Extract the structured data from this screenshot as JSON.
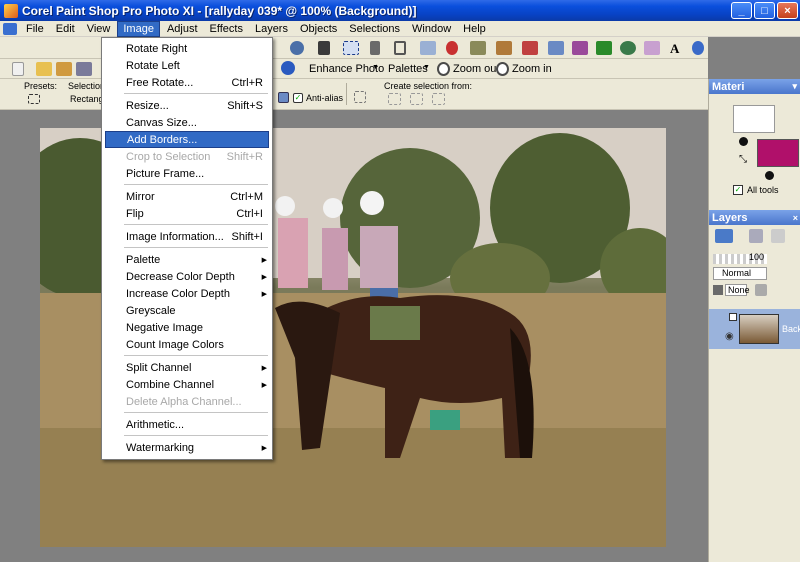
{
  "window": {
    "title": "Corel Paint Shop Pro Photo XI - [rallyday 039* @ 100% (Background)]",
    "controls": {
      "minimize": "_",
      "maximize": "□",
      "close": "×"
    }
  },
  "menubar": {
    "items": [
      {
        "label": "File"
      },
      {
        "label": "Edit"
      },
      {
        "label": "View"
      },
      {
        "label": "Image",
        "active": true
      },
      {
        "label": "Adjust"
      },
      {
        "label": "Effects"
      },
      {
        "label": "Layers"
      },
      {
        "label": "Objects"
      },
      {
        "label": "Selections"
      },
      {
        "label": "Window"
      },
      {
        "label": "Help"
      }
    ]
  },
  "toolbar2": {
    "enhance_photo": "Enhance Photo",
    "palettes": "Palettes",
    "zoom_out": "Zoom out",
    "zoom_in": "Zoom in"
  },
  "tool_options": {
    "presets_label": "Presets:",
    "selection_label": "Selection",
    "selection_value": "Rectangle",
    "anti_alias_label": "Anti-alias",
    "anti_alias_checked": true,
    "create_selection_label": "Create selection from:"
  },
  "image_menu": {
    "groups": [
      [
        {
          "label": "Rotate Right",
          "shortcut": ""
        },
        {
          "label": "Rotate Left",
          "shortcut": ""
        },
        {
          "label": "Free Rotate...",
          "shortcut": "Ctrl+R"
        }
      ],
      [
        {
          "label": "Resize...",
          "shortcut": "Shift+S"
        },
        {
          "label": "Canvas Size...",
          "shortcut": ""
        },
        {
          "label": "Add Borders...",
          "shortcut": "",
          "highlighted": true
        },
        {
          "label": "Crop to Selection",
          "shortcut": "Shift+R",
          "disabled": true
        },
        {
          "label": "Picture Frame...",
          "shortcut": ""
        }
      ],
      [
        {
          "label": "Mirror",
          "shortcut": "Ctrl+M"
        },
        {
          "label": "Flip",
          "shortcut": "Ctrl+I"
        }
      ],
      [
        {
          "label": "Image Information...",
          "shortcut": "Shift+I"
        }
      ],
      [
        {
          "label": "Palette",
          "submenu": true
        },
        {
          "label": "Decrease Color Depth",
          "submenu": true
        },
        {
          "label": "Increase Color Depth",
          "submenu": true
        },
        {
          "label": "Greyscale"
        },
        {
          "label": "Negative Image"
        },
        {
          "label": "Count Image Colors"
        }
      ],
      [
        {
          "label": "Split Channel",
          "submenu": true
        },
        {
          "label": "Combine Channel",
          "submenu": true
        },
        {
          "label": "Delete Alpha Channel...",
          "disabled": true
        }
      ],
      [
        {
          "label": "Arithmetic..."
        }
      ],
      [
        {
          "label": "Watermarking",
          "submenu": true
        }
      ]
    ]
  },
  "materials_panel": {
    "title": "Materi",
    "all_tools_label": "All tools",
    "all_tools_checked": true,
    "foreground_color": "#ffffff",
    "background_color": "#b0106a"
  },
  "layers_panel": {
    "title": "Layers",
    "opacity": "100",
    "blend_mode": "Normal",
    "blend_ranges": "None",
    "layer_name": "Backg"
  },
  "colors": {
    "title_bar": "#0a4fdc",
    "menu_bg": "#ece9d8",
    "highlight": "#316ac5",
    "panel_title": "#4a76cc",
    "workspace": "#808080"
  }
}
